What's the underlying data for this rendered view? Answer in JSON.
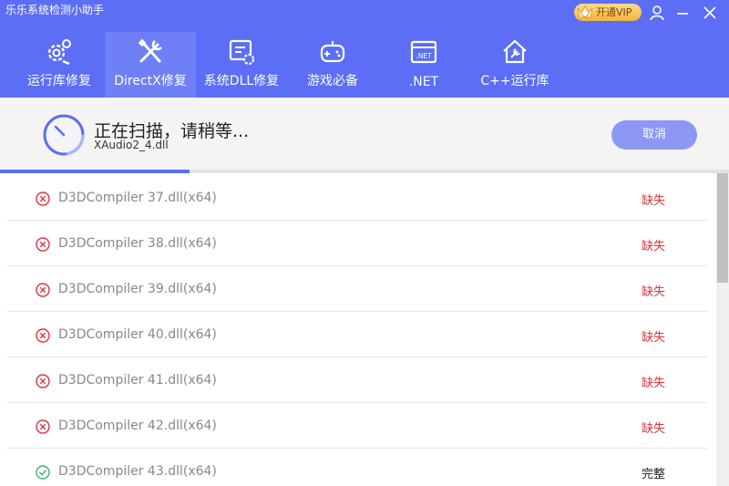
{
  "app": {
    "title": "乐乐系统检测小助手",
    "vip_label": "开通VIP"
  },
  "colors": {
    "brand": "#5b6ef5",
    "missing": "#d9363e",
    "ok": "#3cb371"
  },
  "tabs": [
    {
      "label": "运行库修复",
      "icon": "gear-wrench-icon",
      "active": false
    },
    {
      "label": "DirectX修复",
      "icon": "tools-cross-icon",
      "active": true
    },
    {
      "label": "系统DLL修复",
      "icon": "document-gear-icon",
      "active": false
    },
    {
      "label": "游戏必备",
      "icon": "gamepad-icon",
      "active": false
    },
    {
      "label": ".NET",
      "icon": "dotnet-window-icon",
      "active": false
    },
    {
      "label": "C++运行库",
      "icon": "house-wrench-icon",
      "active": false
    }
  ],
  "scan": {
    "status": "正在扫描，请稍等...",
    "current_file": "XAudio2_4.dll",
    "cancel_label": "取消",
    "progress_fraction": 0.26
  },
  "items": [
    {
      "name": "D3DCompiler 37.dll(x64)",
      "status": "缺失",
      "ok": false
    },
    {
      "name": "D3DCompiler 38.dll(x64)",
      "status": "缺失",
      "ok": false
    },
    {
      "name": "D3DCompiler 39.dll(x64)",
      "status": "缺失",
      "ok": false
    },
    {
      "name": "D3DCompiler 40.dll(x64)",
      "status": "缺失",
      "ok": false
    },
    {
      "name": "D3DCompiler 41.dll(x64)",
      "status": "缺失",
      "ok": false
    },
    {
      "name": "D3DCompiler 42.dll(x64)",
      "status": "缺失",
      "ok": false
    },
    {
      "name": "D3DCompiler 43.dll(x64)",
      "status": "完整",
      "ok": true
    }
  ]
}
